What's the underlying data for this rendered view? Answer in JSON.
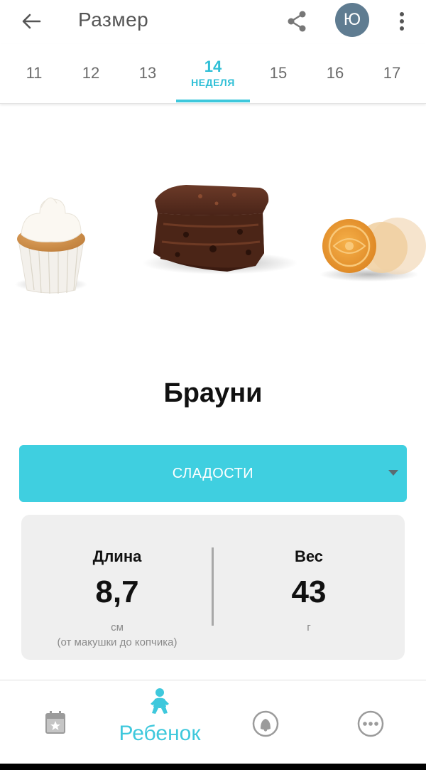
{
  "appbar": {
    "title": "Размер",
    "avatar_initial": "Ю"
  },
  "weeks": {
    "items": [
      {
        "number": "11"
      },
      {
        "number": "12"
      },
      {
        "number": "13"
      },
      {
        "number": "14",
        "label": "НЕДЕЛЯ",
        "active": true
      },
      {
        "number": "15"
      },
      {
        "number": "16"
      },
      {
        "number": "17"
      }
    ]
  },
  "food": {
    "name": "Брауни",
    "category": "СЛАДОСТИ"
  },
  "metrics": {
    "length": {
      "title": "Длина",
      "value": "8,7",
      "unit": "см",
      "note": "(от макушки до копчика)"
    },
    "weight": {
      "title": "Вес",
      "value": "43",
      "unit": "г"
    }
  },
  "bottom_nav": {
    "items": [
      {
        "icon": "calendar-star-icon"
      },
      {
        "icon": "baby-icon",
        "label": "Ребенок",
        "active": true
      },
      {
        "icon": "community-icon"
      },
      {
        "icon": "more-horizontal-icon"
      }
    ]
  },
  "colors": {
    "accent": "#3ec8dc",
    "category_bg": "#3fcfe0",
    "avatar_bg": "#5f7c91",
    "card_bg": "#efefef"
  }
}
